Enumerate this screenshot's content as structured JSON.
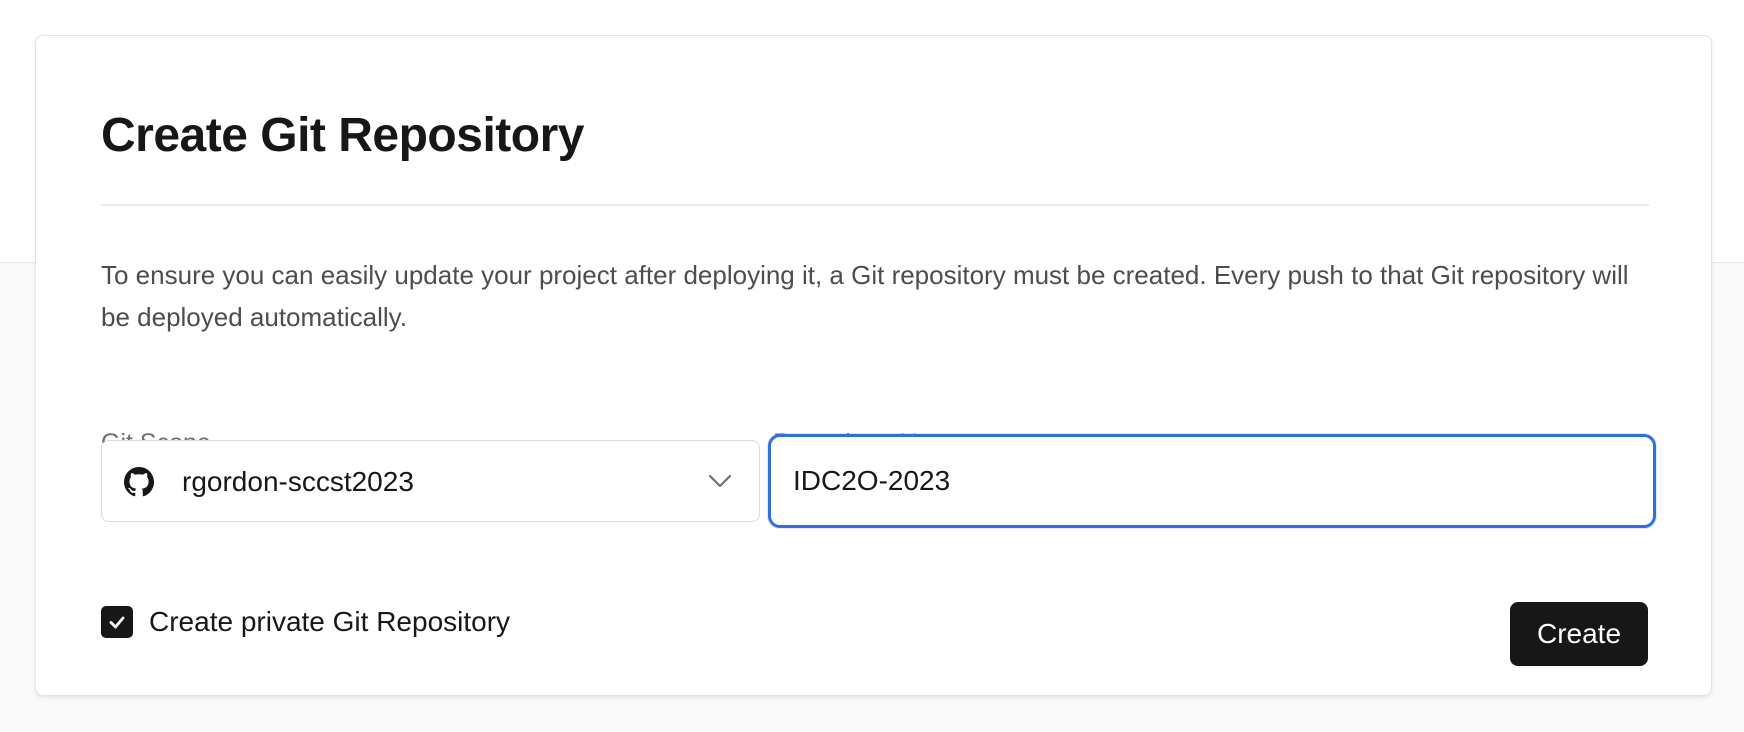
{
  "dialog": {
    "title": "Create Git Repository",
    "description": "To ensure you can easily update your project after deploying it, a Git repository must be created. Every push to that Git repository will be deployed automatically."
  },
  "git_scope": {
    "label": "Git Scope",
    "selected_value": "rgordon-sccst2023",
    "icon": "github-icon"
  },
  "repository_name": {
    "label": "Repository Name",
    "value": "IDC2O-2023"
  },
  "private_checkbox": {
    "label": "Create private Git Repository",
    "checked": true
  },
  "actions": {
    "create_label": "Create"
  },
  "colors": {
    "accent": "#2f6fe0",
    "button_bg": "#171717"
  }
}
